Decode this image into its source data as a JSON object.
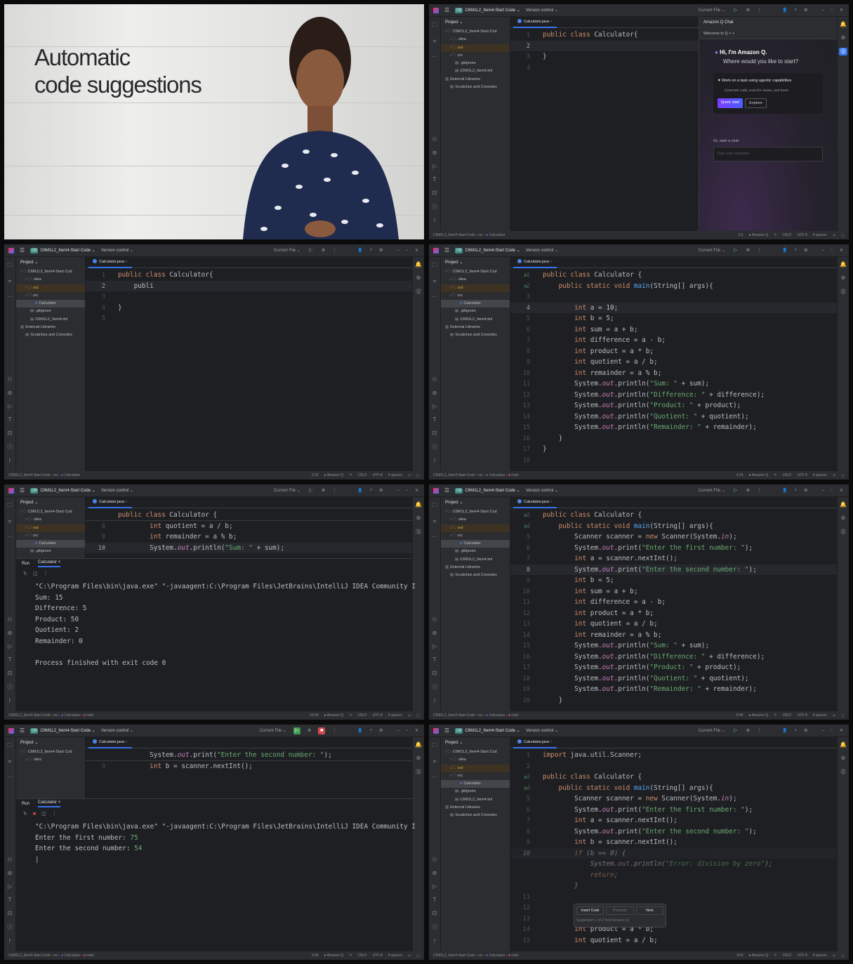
{
  "common": {
    "project_badge": "CR",
    "project_name": "C6M1L2_Item4-Start Code",
    "version_control": "Version control",
    "run_config": "Current File",
    "project_label": "Project",
    "file_tab": "Calculator.java",
    "status_plugin": "Amazon Q",
    "line_ending": "CRLF",
    "encoding": "UTF-8",
    "indent": "4 spaces",
    "breadcrumb_root": "C6M1L2_Item4-Start Code",
    "breadcrumb_src": "src",
    "breadcrumb_class": "Calculator",
    "breadcrumb_method": "main",
    "run_tab": "Run",
    "run_config_tab": "Calculator",
    "colors": {
      "accent": "#3574f0",
      "keyword": "#cf8e6d",
      "string": "#6aab73",
      "bg": "#1e1f22",
      "chrome": "#2b2d30"
    }
  },
  "video": {
    "caption_line1": "Automatic",
    "caption_line2": "code suggestions"
  },
  "panels": [
    {
      "id": "p2",
      "tree": [
        {
          "label": "C6M1L2_Item4-Start Cod",
          "indent": 0,
          "icon": "folder"
        },
        {
          "label": ".idea",
          "indent": 1,
          "icon": "folder"
        },
        {
          "label": "out",
          "indent": 1,
          "icon": "folder",
          "cls": "out"
        },
        {
          "label": "src",
          "indent": 1,
          "icon": "folder"
        },
        {
          "label": ".gitignore",
          "indent": 2,
          "icon": "file"
        },
        {
          "label": "C6M1L2_Item4.iml",
          "indent": 2,
          "icon": "file"
        },
        {
          "label": "External Libraries",
          "indent": 0,
          "icon": "lib"
        },
        {
          "label": "Scratches and Consoles",
          "indent": 1,
          "icon": "file"
        }
      ],
      "code": [
        {
          "n": "1",
          "t": "public class Calculator{"
        },
        {
          "n": "2",
          "t": "",
          "cur": true
        },
        {
          "n": "3",
          "t": "}"
        },
        {
          "n": "4",
          "t": ""
        }
      ],
      "status_pos": "2:5",
      "show_method": false,
      "chat": {
        "title": "Amazon Q Chat",
        "tab": "Welcome to Q",
        "greeting": "Hi, I'm Amazon Q.",
        "prompt": "Where would you like to start?",
        "card_title": "Work on a task using agentic capabilities",
        "card_sub": "Generate code, scan for issues, and more.",
        "quick_start": "Quick start",
        "explore": "Explore",
        "or_chat": "Or, start a chat",
        "input_placeholder": "Type your question"
      }
    },
    {
      "id": "p3",
      "tree": [
        {
          "label": "C6M1L2_Item4-Start Cod",
          "indent": 0,
          "icon": "folder"
        },
        {
          "label": ".idea",
          "indent": 1,
          "icon": "folder"
        },
        {
          "label": "out",
          "indent": 1,
          "icon": "folder",
          "cls": "out"
        },
        {
          "label": "src",
          "indent": 1,
          "icon": "folder"
        },
        {
          "label": "Calculator",
          "indent": 3,
          "icon": "class",
          "cls": "sel"
        },
        {
          "label": ".gitignore",
          "indent": 2,
          "icon": "file"
        },
        {
          "label": "C6M1L2_Item4.iml",
          "indent": 2,
          "icon": "file"
        },
        {
          "label": "External Libraries",
          "indent": 0,
          "icon": "lib"
        },
        {
          "label": "Scratches and Consoles",
          "indent": 1,
          "icon": "file"
        }
      ],
      "code": [
        {
          "n": "1",
          "t": "public class Calculator{"
        },
        {
          "n": "2",
          "t": "    publi",
          "cur": true
        },
        {
          "n": "3",
          "t": ""
        },
        {
          "n": "4",
          "t": "}"
        },
        {
          "n": "5",
          "t": ""
        }
      ],
      "status_pos": "2:10",
      "show_method": false
    },
    {
      "id": "p4",
      "tree": "full",
      "code": [
        {
          "n": "1",
          "t": "public class Calculator {",
          "run": true
        },
        {
          "n": "2",
          "t": "    public static void main(String[] args){",
          "run": true
        },
        {
          "n": "3",
          "t": ""
        },
        {
          "n": "4",
          "t": "        int a = 10;",
          "cur": true
        },
        {
          "n": "5",
          "t": "        int b = 5;"
        },
        {
          "n": "6",
          "t": "        int sum = a + b;"
        },
        {
          "n": "7",
          "t": "        int difference = a - b;"
        },
        {
          "n": "8",
          "t": "        int product = a * b;"
        },
        {
          "n": "9",
          "t": "        int quotient = a / b;"
        },
        {
          "n": "10",
          "t": "        int remainder = a % b;"
        },
        {
          "n": "11",
          "t": "        System.out.println(\"Sum: \" + sum);"
        },
        {
          "n": "12",
          "t": "        System.out.println(\"Difference: \" + difference);"
        },
        {
          "n": "13",
          "t": "        System.out.println(\"Product: \" + product);"
        },
        {
          "n": "14",
          "t": "        System.out.println(\"Quotient: \" + quotient);"
        },
        {
          "n": "15",
          "t": "        System.out.println(\"Remainder: \" + remainder);"
        },
        {
          "n": "16",
          "t": "    }"
        },
        {
          "n": "17",
          "t": "}"
        },
        {
          "n": "18",
          "t": ""
        }
      ],
      "status_pos": "4:20",
      "show_method": true
    },
    {
      "id": "p5",
      "tree": [
        {
          "label": "C6M1L2_Item4-Start Cod",
          "indent": 0,
          "icon": "folder"
        },
        {
          "label": ".idea",
          "indent": 1,
          "icon": "folder"
        },
        {
          "label": "out",
          "indent": 1,
          "icon": "folder",
          "cls": "out"
        },
        {
          "label": "src",
          "indent": 1,
          "icon": "folder"
        },
        {
          "label": "Calculator",
          "indent": 3,
          "icon": "class",
          "cls": "sel"
        },
        {
          "label": ".gitignore",
          "indent": 2,
          "icon": "file"
        }
      ],
      "code": [
        {
          "n": "",
          "t": "public class Calculator {",
          "sticky": true
        },
        {
          "n": "8",
          "t": "        int quotient = a / b;"
        },
        {
          "n": "9",
          "t": "        int remainder = a % b;"
        },
        {
          "n": "10",
          "t": "        System.out.println(\"Sum: \" + sum);",
          "cur": true
        }
      ],
      "console": [
        {
          "t": "\"C:\\Program Files\\bin\\java.exe\" \"-javaagent:C:\\Program Files\\JetBrains\\IntelliJ IDEA Community I"
        },
        {
          "t": "Sum: 15"
        },
        {
          "t": "Difference: 5"
        },
        {
          "t": "Product: 50"
        },
        {
          "t": "Quotient: 2"
        },
        {
          "t": "Remainder: 0"
        },
        {
          "t": ""
        },
        {
          "t": "Process finished with exit code 0"
        }
      ],
      "status_pos": "10:43",
      "show_method": true
    },
    {
      "id": "p6",
      "tree": "full",
      "code": [
        {
          "n": "3",
          "t": "public class Calculator {",
          "run": true
        },
        {
          "n": "4",
          "t": "    public static void main(String[] args){",
          "run": true
        },
        {
          "n": "5",
          "t": "        Scanner scanner = new Scanner(System.in);"
        },
        {
          "n": "6",
          "t": "        System.out.print(\"Enter the first number: \");"
        },
        {
          "n": "7",
          "t": "        int a = scanner.nextInt();"
        },
        {
          "n": "8",
          "t": "        System.out.print(\"Enter the second number: \");",
          "cur": true
        },
        {
          "n": "9",
          "t": "        int b = 5;"
        },
        {
          "n": "10",
          "t": "        int sum = a + b;"
        },
        {
          "n": "11",
          "t": "        int difference = a - b;"
        },
        {
          "n": "12",
          "t": "        int product = a * b;"
        },
        {
          "n": "13",
          "t": "        int quotient = a / b;"
        },
        {
          "n": "14",
          "t": "        int remainder = a % b;"
        },
        {
          "n": "15",
          "t": "        System.out.println(\"Sum: \" + sum);"
        },
        {
          "n": "16",
          "t": "        System.out.println(\"Difference: \" + difference);"
        },
        {
          "n": "17",
          "t": "        System.out.println(\"Product: \" + product);"
        },
        {
          "n": "18",
          "t": "        System.out.println(\"Quotient: \" + quotient);"
        },
        {
          "n": "19",
          "t": "        System.out.println(\"Remainder: \" + remainder);"
        },
        {
          "n": "20",
          "t": "    }"
        }
      ],
      "status_pos": "8:40",
      "show_method": true
    },
    {
      "id": "p7",
      "tree": [
        {
          "label": "C6M1L2_Item4-Start Cod",
          "indent": 0,
          "icon": "folder"
        },
        {
          "label": ".idea",
          "indent": 1,
          "icon": "folder"
        }
      ],
      "code": [
        {
          "n": "",
          "t": "        System.out.print(\"Enter the second number: \");",
          "sticky": true
        },
        {
          "n": "9",
          "t": "        int b = scanner.nextInt();"
        }
      ],
      "console": [
        {
          "t": "\"C:\\Program Files\\bin\\java.exe\" \"-javaagent:C:\\Program Files\\JetBrains\\IntelliJ IDEA Community I"
        },
        {
          "t": "Enter the first number: ",
          "input": "75"
        },
        {
          "t": "Enter the second number: ",
          "input": "54"
        },
        {
          "t": "|"
        }
      ],
      "running": true,
      "status_pos": "9:35",
      "show_method": true
    },
    {
      "id": "p8",
      "tree": "full",
      "code": [
        {
          "n": "1",
          "t": "import java.util.Scanner;"
        },
        {
          "n": "2",
          "t": ""
        },
        {
          "n": "3",
          "t": "public class Calculator {",
          "run": true
        },
        {
          "n": "4",
          "t": "    public static void main(String[] args){",
          "run": true
        },
        {
          "n": "5",
          "t": "        Scanner scanner = new Scanner(System.in);"
        },
        {
          "n": "6",
          "t": "        System.out.print(\"Enter the first number: \");"
        },
        {
          "n": "7",
          "t": "        int a = scanner.nextInt();"
        },
        {
          "n": "8",
          "t": "        System.out.print(\"Enter the second number: \");"
        },
        {
          "n": "9",
          "t": "        int b = scanner.nextInt();"
        },
        {
          "n": "10",
          "t": "        if (b == 0) {",
          "cur": true,
          "ghost": true
        },
        {
          "n": "",
          "t": "            System.out.println(\"Error: division by zero\");",
          "ghost": true
        },
        {
          "n": "",
          "t": "            return;",
          "ghost": true
        },
        {
          "n": "",
          "t": "        }",
          "ghost": true
        },
        {
          "n": "11",
          "t": ""
        },
        {
          "n": "12",
          "t": ""
        },
        {
          "n": "13",
          "t": "        int difference = a - b;"
        },
        {
          "n": "14",
          "t": "        int product = a * b;"
        },
        {
          "n": "15",
          "t": "        int quotient = a / b;"
        }
      ],
      "suggestion": {
        "insert": "Insert Code",
        "previous": "Previous",
        "next": "Next",
        "info": "Suggestion 1 of 2 from Amazon Q"
      },
      "status_pos": "10:9",
      "show_method": true
    }
  ],
  "full_tree": [
    {
      "label": "C6M1L2_Item4-Start Cod",
      "indent": 0,
      "icon": "folder"
    },
    {
      "label": ".idea",
      "indent": 1,
      "icon": "folder"
    },
    {
      "label": "out",
      "indent": 1,
      "icon": "folder",
      "cls": "out"
    },
    {
      "label": "src",
      "indent": 1,
      "icon": "folder"
    },
    {
      "label": "Calculator",
      "indent": 3,
      "icon": "class",
      "cls": "sel"
    },
    {
      "label": ".gitignore",
      "indent": 2,
      "icon": "file"
    },
    {
      "label": "C6M1L2_Item4.iml",
      "indent": 2,
      "icon": "file"
    },
    {
      "label": "External Libraries",
      "indent": 0,
      "icon": "lib"
    },
    {
      "label": "Scratches and Consoles",
      "indent": 1,
      "icon": "file"
    }
  ]
}
